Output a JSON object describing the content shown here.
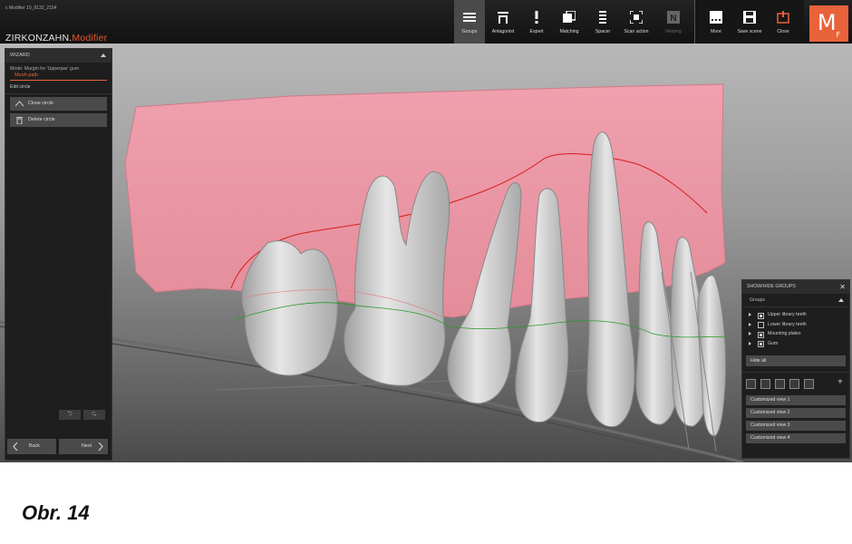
{
  "app": {
    "version": "c Modifier 10_8132_2154",
    "brand_main": "ZIRKONZAHN.",
    "brand_accent": "Modifier",
    "logo_main": "M",
    "logo_sub": "F"
  },
  "toolbar": {
    "items": [
      {
        "label": "Groups",
        "icon": "menu-icon"
      },
      {
        "label": "Antagonist",
        "icon": "antagonist-icon"
      },
      {
        "label": "Expert",
        "icon": "exclamation-icon"
      },
      {
        "label": "Matching",
        "icon": "matching-icon"
      },
      {
        "label": "Spacer",
        "icon": "spacer-icon"
      },
      {
        "label": "Scan action",
        "icon": "scan-icon"
      },
      {
        "label": "Nesting",
        "icon": "nesting-icon"
      }
    ],
    "right": [
      {
        "label": "More",
        "icon": "more-icon"
      },
      {
        "label": "Save scene",
        "icon": "save-icon"
      },
      {
        "label": "Close",
        "icon": "power-icon"
      }
    ]
  },
  "wizard": {
    "title": "WIZARD",
    "mode": "Mode: Margin for 'Upperjaw' gum",
    "mesh_path": "Mesh path",
    "edit_circle": "Edit circle",
    "close_circle": "Close circle",
    "delete_circle": "Delete circle",
    "undo": "⮌",
    "redo": "⮎",
    "back": "Back",
    "next": "Next"
  },
  "groups_panel": {
    "title": "SHOW/HIDE GROUPS",
    "close": "✕",
    "groups_label": "Groups",
    "items": [
      {
        "label": "Upper library teeth",
        "checked": true
      },
      {
        "label": "Lower library teeth",
        "checked": false
      },
      {
        "label": "Mounting plates",
        "checked": true
      },
      {
        "label": "Gum",
        "checked": true
      }
    ],
    "hide_all": "Hide all",
    "views": [
      "Customized view 1",
      "Customized view 2",
      "Customized view 3",
      "Customized view 4"
    ],
    "add": "+"
  },
  "caption": "Obr. 14",
  "colors": {
    "accent": "#e8623a",
    "gum": "#e8909e",
    "tooth": "#d4d4d4"
  }
}
